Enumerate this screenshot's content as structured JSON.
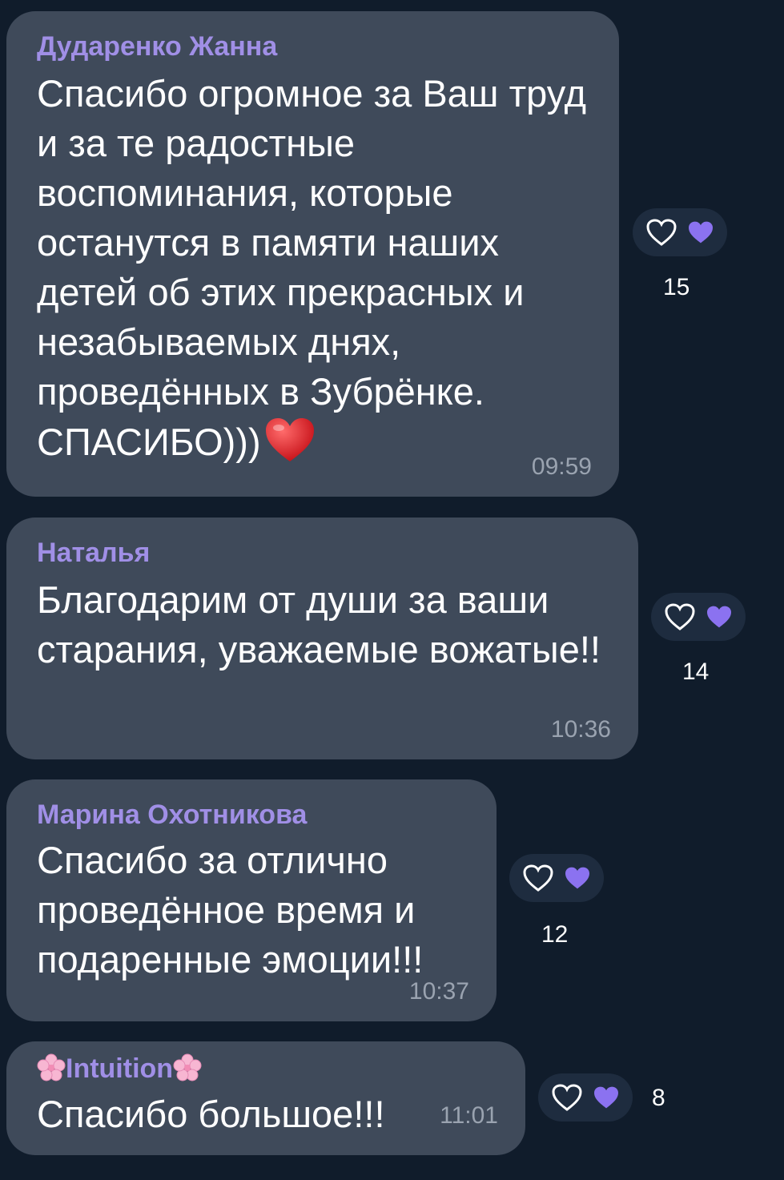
{
  "messages": [
    {
      "author": "Дударенко Жанна",
      "text": "Спасибо огромное за Ваш труд и за те радостные воспоминания, которые останутся в памяти наших детей об этих прекрасных и незабываемых днях, проведённых в Зубрёнке. СПАСИБО)))",
      "emoji": "red-heart",
      "time": "09:59",
      "reaction_count": "15"
    },
    {
      "author": "Наталья",
      "text": "Благодарим от души за ваши старания, уважаемые вожатые!!",
      "time": "10:36",
      "reaction_count": "14"
    },
    {
      "author": "Марина Охотникова",
      "text": "Спасибо за отлично проведённое время и подаренные эмоции!!!",
      "time": "10:37",
      "reaction_count": "12"
    },
    {
      "author": "Intuition",
      "author_decoration": "cherry-blossom",
      "text": "Спасибо большое!!!",
      "time": "11:01",
      "reaction_count": "8"
    }
  ],
  "colors": {
    "background": "#101c2b",
    "bubble": "#3f4a5a",
    "author": "#a08fe6",
    "reaction_heart": "#8b72f0",
    "pill": "#1e2c3f"
  }
}
